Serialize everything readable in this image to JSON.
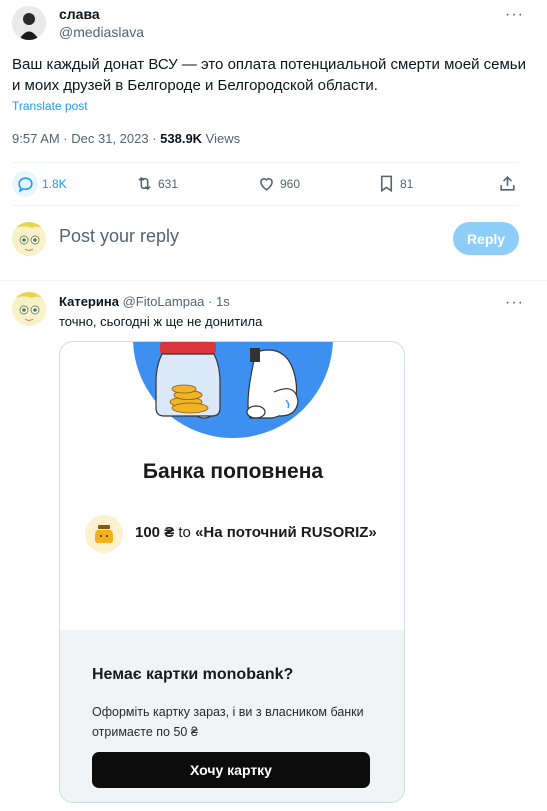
{
  "tweet": {
    "author_name": "слава",
    "author_handle": "@mediaslava",
    "text": "Ваш каждый донат ВСУ — это оплата потенциальной смерти моей семьи и моих друзей в Белгороде и Белгородской области.",
    "translate_label": "Translate post",
    "time": "9:57 AM · Dec 31, 2023 · ",
    "views_count": "538.9K",
    "views_label": " Views",
    "more_icon": "more-icon"
  },
  "actions": {
    "replies": "1.8K",
    "reposts": "631",
    "likes": "960",
    "bookmarks": "81"
  },
  "composer": {
    "placeholder": "Post your reply",
    "reply_button": "Reply"
  },
  "reply": {
    "author_name": "Катерина",
    "author_handle": "@FitoLampaa",
    "time": "· 1s",
    "text": "точно, сьогодні ж ще не донитила"
  },
  "card": {
    "title": "Банка поповнена",
    "amount": "100 ₴",
    "to": " to ",
    "destination": "«На поточний RUSORIZ»",
    "no_card_title": "Немає картки monobank?",
    "offer_text": "Оформіть картку зараз, і ви з власником банки отримаєте по 50 ₴",
    "cta_label": "Хочу картку"
  },
  "colors": {
    "accent": "#1d9bf0",
    "reply_button_bg": "#8ecdf8",
    "circle_blue": "#3d8ff0",
    "card_lower_bg": "#f2f3f5"
  }
}
